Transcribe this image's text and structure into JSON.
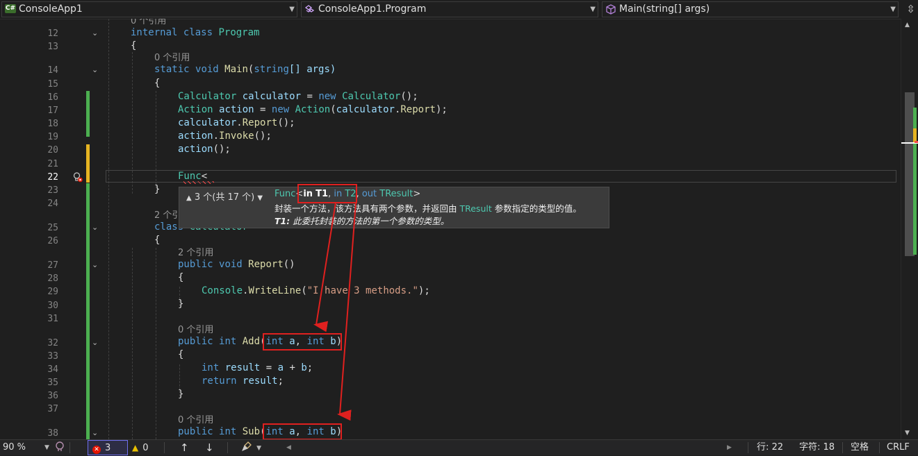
{
  "navbar": {
    "project": "ConsoleApp1",
    "class_scope": "ConsoleApp1.Program",
    "member_scope": "Main(string[] args)",
    "project_icon_label": "C#",
    "split_icon": "split-editor-icon"
  },
  "editor": {
    "line_numbers": [
      "12",
      "13",
      "14",
      "15",
      "16",
      "17",
      "18",
      "19",
      "20",
      "21",
      "22",
      "23",
      "24",
      "25",
      "26",
      "27",
      "28",
      "29",
      "30",
      "31",
      "32",
      "33",
      "34",
      "35",
      "36",
      "37",
      "38"
    ],
    "current_line": "22",
    "codelens": {
      "top_partial": "0 个引用",
      "main": "0 个引用",
      "calculator_class": "2 个引用",
      "report": "2 个引用",
      "add": "0 个引用",
      "sub": "0 个引用"
    },
    "code": {
      "l12": [
        "internal",
        "class",
        "Program"
      ],
      "l13": "{",
      "l14": [
        "static",
        "void",
        "Main",
        "(",
        "string",
        "[] args)"
      ],
      "l15": "{",
      "l16": [
        "Calculator",
        "calculator",
        " = ",
        "new",
        "Calculator",
        "();"
      ],
      "l17": [
        "Action",
        "action",
        " = ",
        "new",
        "Action",
        "(",
        "calculator",
        ".",
        "Report",
        ");"
      ],
      "l18": [
        "calculator",
        ".",
        "Report",
        "();"
      ],
      "l19": [
        "action",
        ".",
        "Invoke",
        "();"
      ],
      "l20": [
        "action",
        "();"
      ],
      "l22": [
        "Func",
        "<"
      ],
      "l23": "}",
      "l25": [
        "class",
        "Calculator"
      ],
      "l26": "{",
      "l27": [
        "public",
        "void",
        "Report",
        "()"
      ],
      "l28": "{",
      "l29": [
        "Console",
        ".",
        "WriteLine",
        "(",
        "\"I have 3 methods.\"",
        ");"
      ],
      "l30": "}",
      "l32": [
        "public",
        "int",
        "Add",
        "(",
        "int",
        "a",
        ", ",
        "int",
        "b",
        ")"
      ],
      "l33": "{",
      "l34": [
        "int",
        "result",
        " = ",
        "a",
        " + ",
        "b",
        ";"
      ],
      "l35": [
        "return",
        "result",
        ";"
      ],
      "l36": "}",
      "l38": [
        "public",
        "int",
        "Sub",
        "(",
        "int",
        "a",
        ", ",
        "int",
        "b",
        ")"
      ]
    }
  },
  "tooltip": {
    "overload_counter": "3 个(共 17 个)",
    "sig_func": "Func",
    "sig_lt": "<",
    "sig_in1": "in",
    "sig_t1": "T1",
    "sig_comma1": ", ",
    "sig_in2": "in",
    "sig_t2": "T2",
    "sig_comma2": ", ",
    "sig_out": "out",
    "sig_tresult": "TResult",
    "sig_gt": ">",
    "desc_before": "封装一个方法，该方法具有两个参数，并返回由 ",
    "desc_type": "TResult",
    "desc_after": " 参数指定的类型的值。",
    "param_name": "T1:",
    "param_desc": " 此委托封装的方法的第一个参数的类型。"
  },
  "statusbar": {
    "zoom": "90 %",
    "errors": "3",
    "warnings": "0",
    "line": "行: 22",
    "char": "字符: 18",
    "whitespace": "空格",
    "line_ending": "CRLF"
  },
  "colors": {
    "keyword": "#569cd6",
    "type": "#4ec9b0",
    "method": "#dcdcaa",
    "variable": "#9cdcfe",
    "string": "#d69d85",
    "annotation_red": "#e0201f",
    "change_green": "#4caf50"
  }
}
